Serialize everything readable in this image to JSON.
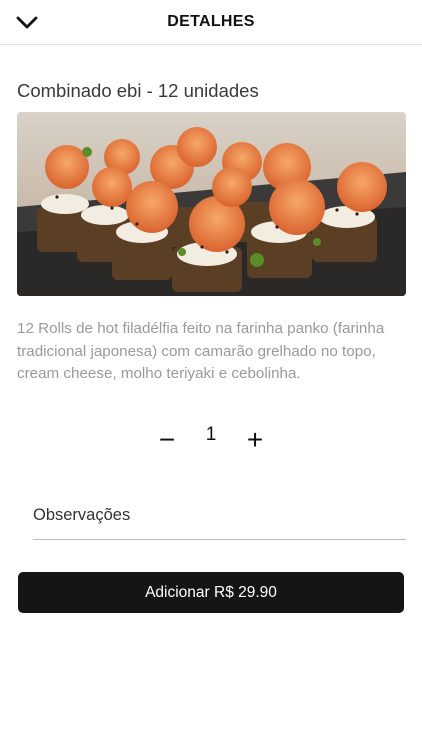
{
  "header": {
    "back_icon": "chevron-down-icon",
    "title": "DETALHES"
  },
  "product": {
    "name": "Combinado ebi - 12 unidades",
    "image": "photo of shrimp sushi rolls on slate",
    "description": "12 Rolls de hot filadélfia feito na farinha panko (farinha tradicional japonesa) com camarão grelhado no topo, cream cheese, molho teriyaki e cebolinha."
  },
  "quantity": {
    "minus_symbol": "−",
    "value": "1",
    "plus_symbol": "+"
  },
  "notes": {
    "label": "Observações"
  },
  "cart": {
    "add_label": "Adicionar R$ 29.90"
  }
}
